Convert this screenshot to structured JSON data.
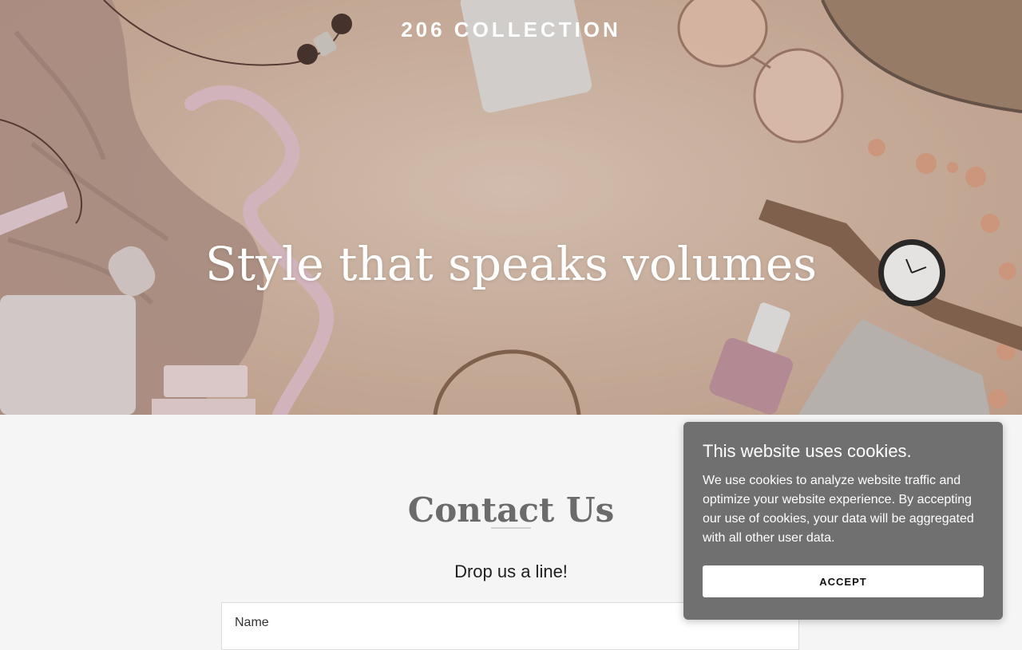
{
  "hero": {
    "brand": "206 COLLECTION",
    "title": "Style that speaks volumes"
  },
  "contact": {
    "title": "Contact Us",
    "subtitle": "Drop us a line!",
    "name_label": "Name"
  },
  "cookie_banner": {
    "title": "This website uses cookies.",
    "text": "We use cookies to analyze website traffic and optimize your website experience. By accepting our use of cookies, your data will be aggregated with all other user data.",
    "accept_label": "ACCEPT"
  },
  "colors": {
    "hero_background": "#ddc1ae",
    "page_background": "#f5f5f5",
    "cookie_background": "#707070",
    "heading_gray": "#6b6b6b"
  }
}
